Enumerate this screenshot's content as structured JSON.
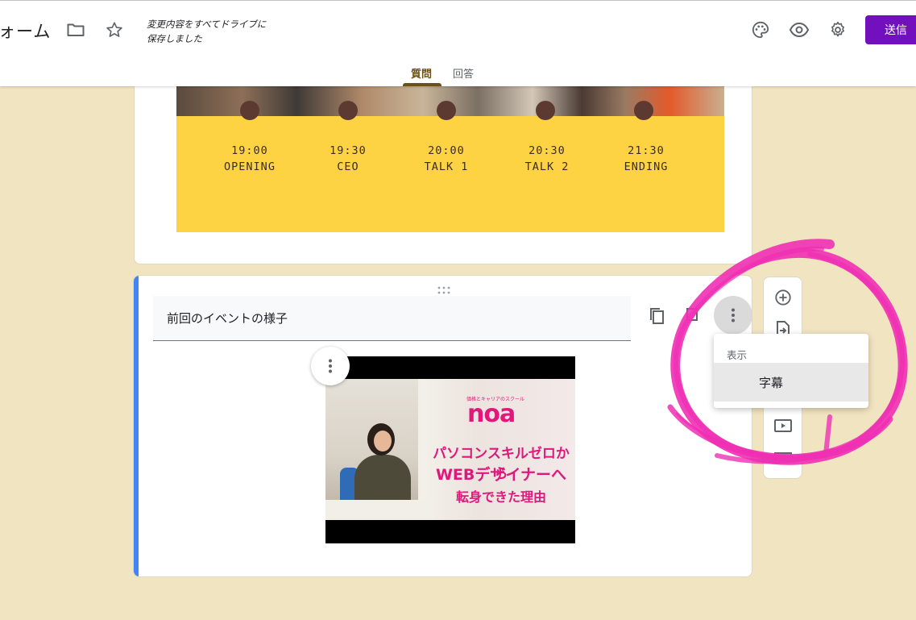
{
  "header": {
    "app_title": "ォーム",
    "save_status_line1": "変更内容をすべてドライブに",
    "save_status_line2": "保存しました",
    "send_label": "送信",
    "send_color": "#7210be",
    "icons": [
      "folder-icon",
      "star-icon",
      "palette-icon",
      "preview-icon",
      "gear-icon"
    ]
  },
  "tabs": [
    {
      "label": "質問",
      "active": true
    },
    {
      "label": "回答",
      "active": false
    }
  ],
  "timeline": [
    {
      "time": "19:00",
      "label": "OPENING"
    },
    {
      "time": "19:30",
      "label": "CEO"
    },
    {
      "time": "20:00",
      "label": "TALK 1"
    },
    {
      "time": "20:30",
      "label": "TALK 2"
    },
    {
      "time": "21:30",
      "label": "ENDING"
    }
  ],
  "video_item": {
    "title": "前回のイベントの様子",
    "thumbnail": {
      "brand_small": "価格とキャリアのスクール",
      "brand": "noa",
      "line1": "パソコンスキルゼロから",
      "line2": "WEBデザイナーへ",
      "line3": "転身できた理由"
    }
  },
  "menu": {
    "heading": "表示",
    "item": "字幕"
  },
  "colors": {
    "background": "#f1e4c0",
    "accent_blue": "#4285f4",
    "timeline_yellow": "#fdd243",
    "annotation_pink": "#ef2fb4"
  }
}
